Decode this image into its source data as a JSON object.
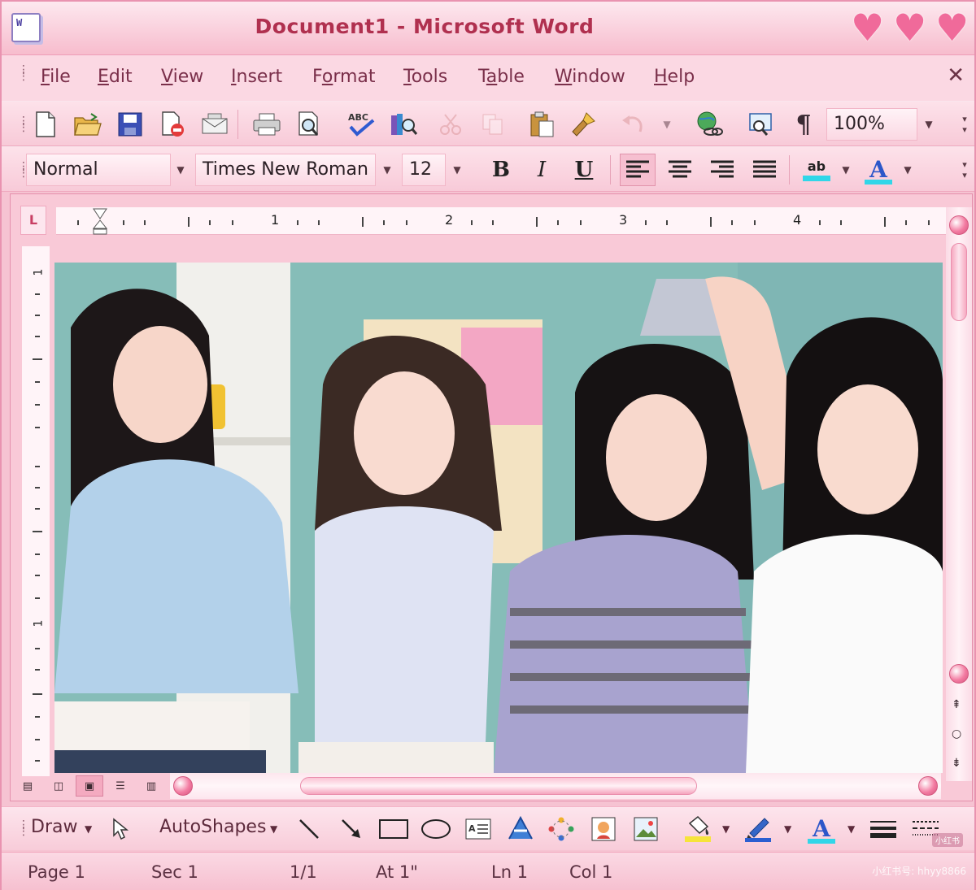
{
  "window": {
    "title": "Document1 - Microsoft Word",
    "app_icon_text": "W",
    "heart_glyph": "♥"
  },
  "menu": {
    "items": [
      {
        "label": "File",
        "mnemonic": "F"
      },
      {
        "label": "Edit",
        "mnemonic": "E"
      },
      {
        "label": "View",
        "mnemonic": "V"
      },
      {
        "label": "Insert",
        "mnemonic": "I"
      },
      {
        "label": "Format",
        "mnemonic": "o"
      },
      {
        "label": "Tools",
        "mnemonic": "T"
      },
      {
        "label": "Table",
        "mnemonic": "a"
      },
      {
        "label": "Window",
        "mnemonic": "W"
      },
      {
        "label": "Help",
        "mnemonic": "H"
      }
    ],
    "close_glyph": "✕"
  },
  "standard_toolbar": {
    "zoom_value": "100%",
    "pilcrow": "¶",
    "spelling_label": "ABC"
  },
  "formatting_toolbar": {
    "style_value": "Normal",
    "font_value": "Times New Roman",
    "size_value": "12",
    "bold_label": "B",
    "italic_label": "I",
    "underline_label": "U",
    "highlight_label": "ab",
    "font_color_label": "A"
  },
  "ruler": {
    "corner_label": "L",
    "h_numbers": [
      "1",
      "2",
      "3",
      "4"
    ],
    "v_numbers": [
      "1",
      "1"
    ]
  },
  "drawing_toolbar": {
    "draw_label": "Draw",
    "autoshapes_label": "AutoShapes",
    "font_color_label": "A"
  },
  "status": {
    "page": "Page  1",
    "section": "Sec  1",
    "pages": "1/1",
    "at": "At  1\"",
    "line": "Ln  1",
    "col": "Col  1",
    "watermark": "小红书号: hhyy8866",
    "badge": "小红书"
  },
  "colors": {
    "accent": "#f06a9a",
    "title_text": "#b0304f",
    "chrome_pink": "#f6c3d2"
  }
}
